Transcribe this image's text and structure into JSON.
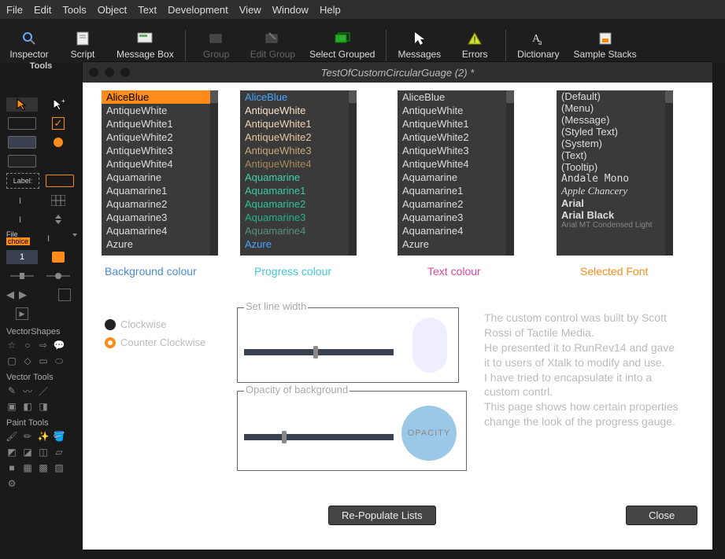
{
  "menu": [
    "File",
    "Edit",
    "Tools",
    "Object",
    "Text",
    "Development",
    "View",
    "Window",
    "Help"
  ],
  "toolbar": {
    "inspector": "Inspector",
    "script": "Script",
    "msgbox": "Message Box",
    "group": "Group",
    "editgroup": "Edit Group",
    "selectgrouped": "Select Grouped",
    "messages": "Messages",
    "errors": "Errors",
    "dictionary": "Dictionary",
    "samplestacks": "Sample Stacks"
  },
  "toolsLabel": "Tools",
  "palette": {
    "label": "Label:",
    "file": "File",
    "choice": "choice",
    "one": "1",
    "vectorshapes": "VectorShapes",
    "vectortools": "Vector Tools",
    "painttools": "Paint Tools"
  },
  "window": {
    "title": "TestOfCustomCircularGuage (2) *"
  },
  "colorItems": [
    "AliceBlue",
    "AntiqueWhite",
    "AntiqueWhite1",
    "AntiqueWhite2",
    "AntiqueWhite3",
    "AntiqueWhite4",
    "Aquamarine",
    "Aquamarine1",
    "Aquamarine2",
    "Aquamarine3",
    "Aquamarine4",
    "Azure"
  ],
  "progressColors": [
    "#4aa3ff",
    "#f8e0c8",
    "#f2d4b4",
    "#e8c8a0",
    "#c8a878",
    "#a88858",
    "#40d0b0",
    "#38c8a8",
    "#30c0a0",
    "#28b090",
    "#5a9080",
    "#4aa3ff"
  ],
  "fontItems": [
    "(Default)",
    "(Menu)",
    "(Message)",
    "(Styled Text)",
    "(System)",
    "(Text)",
    "(Tooltip)",
    "Andale Mono",
    "Apple Chancery",
    "Arial",
    "Arial Black",
    "Arial MT Condensed Light"
  ],
  "captions": {
    "bg": "Background colour",
    "prog": "Progress colour",
    "text": "Text colour",
    "font": "Selected Font"
  },
  "radios": {
    "cw": "Clockwise",
    "ccw": "Counter Clockwise"
  },
  "panels": {
    "linewidth": "Set line width",
    "opacity": "Opacity of background"
  },
  "opacityLabel": "OPACITY",
  "buttons": {
    "repop": "Re-Populate Lists",
    "close": "Close"
  },
  "description": "The custom control was built by Scott Rossi of Tactile Media.\nHe presented it to RunRev14 and gave it to users of Xtalk to modify and use.\nI have tried to encapsulate it into a custom contrl.\nThis page shows how certain properties change the look of the progress gauge."
}
